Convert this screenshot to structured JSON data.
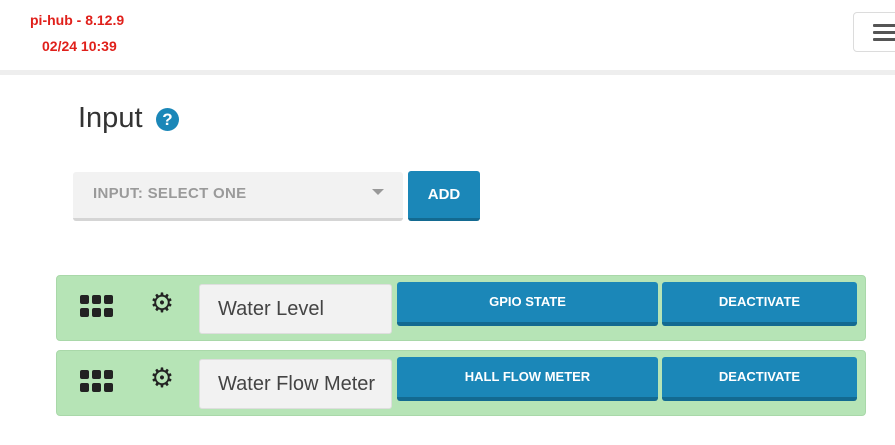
{
  "header": {
    "brand": "pi-hub - 8.12.9",
    "datetime": "02/24 10:39"
  },
  "page": {
    "title": "Input",
    "help_icon": "question-circle-icon"
  },
  "input_select": {
    "value": "INPUT: SELECT ONE"
  },
  "add_button": {
    "label": "ADD"
  },
  "inputs": [
    {
      "name": "Water Level",
      "type_label": "GPIO STATE",
      "action_label": "DEACTIVATE"
    },
    {
      "name": "Water Flow Meter",
      "type_label": "HALL FLOW METER",
      "action_label": "DEACTIVATE"
    }
  ],
  "colors": {
    "brand": "#e0201b",
    "primary_button": "#1b87b8",
    "active_row": "#b6e4b6"
  }
}
